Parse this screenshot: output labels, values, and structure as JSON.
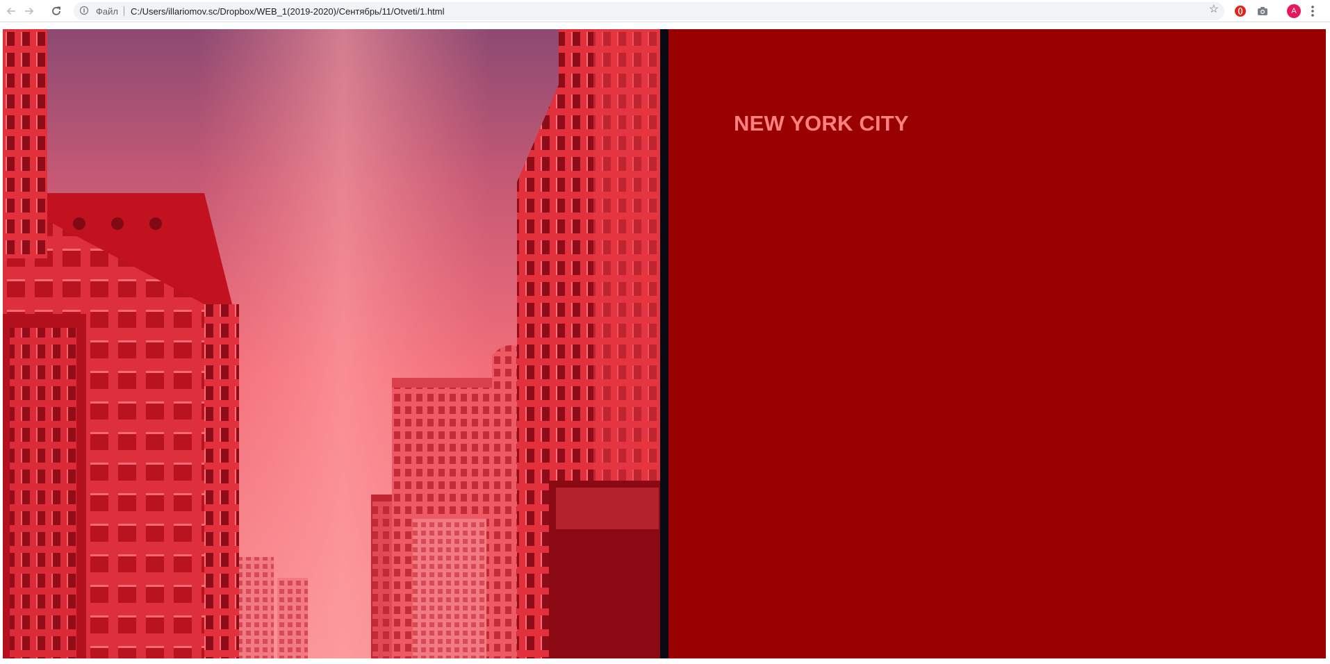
{
  "browser": {
    "back_icon": "arrow-left-icon",
    "forward_icon": "arrow-right-icon",
    "reload_icon": "reload-icon",
    "site_info_icon": "info-icon",
    "scheme_label": "Файл",
    "url": "C:/Users/illariomov.sc/Dropbox/WEB_1(2019-2020)/Сентябрь/11/Otveti/1.html",
    "bookmark_icon": "star-icon",
    "extensions": [
      "opera-extension-icon",
      "camera-icon"
    ],
    "profile_initial": "A",
    "menu_icon": "vertical-dots-icon"
  },
  "page": {
    "title": "NEW YORK CITY",
    "colors": {
      "panel_background": "#990000",
      "title_color": "#ff8080",
      "photo_tint": "#ff5a64"
    }
  }
}
